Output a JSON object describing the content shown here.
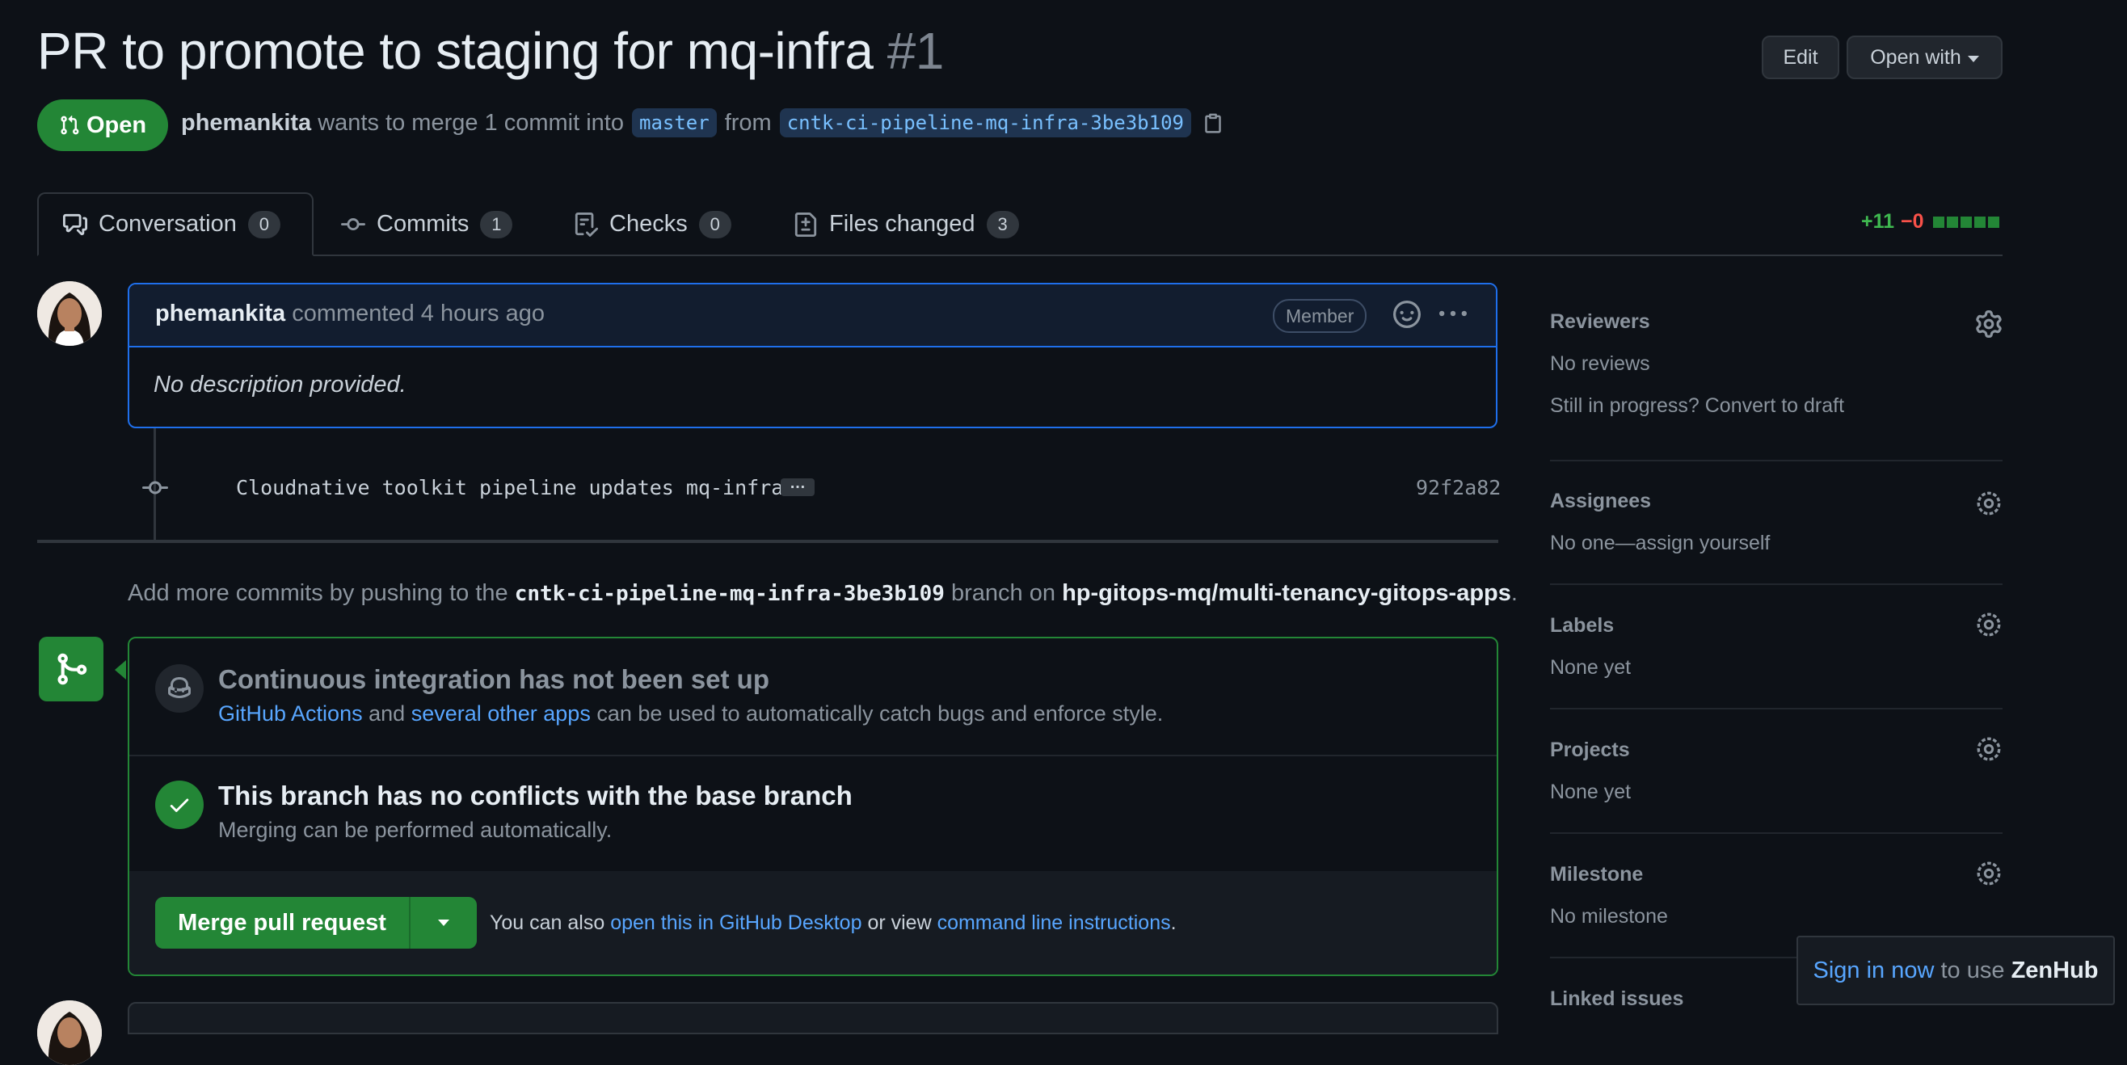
{
  "pr": {
    "title": "PR to promote to staging for mq-infra",
    "number": "#1",
    "state": "Open",
    "author": "phemankita",
    "merge_text": "wants to merge 1 commit into",
    "base_branch": "master",
    "from_text": "from",
    "head_branch": "cntk-ci-pipeline-mq-infra-3be3b109"
  },
  "header": {
    "edit_label": "Edit",
    "open_with_label": "Open with"
  },
  "tabs": [
    {
      "label": "Conversation",
      "count": "0"
    },
    {
      "label": "Commits",
      "count": "1"
    },
    {
      "label": "Checks",
      "count": "0"
    },
    {
      "label": "Files changed",
      "count": "3"
    }
  ],
  "diffstat": {
    "additions": "+11",
    "deletions": "−0"
  },
  "comment": {
    "author": "phemankita",
    "action": "commented 4 hours ago",
    "badge": "Member",
    "body": "No description provided."
  },
  "commit": {
    "message": "Cloudnative toolkit pipeline updates mq-infra",
    "more": "…",
    "sha": "92f2a82"
  },
  "push_note": {
    "prefix": "Add more commits by pushing to the",
    "branch": "cntk-ci-pipeline-mq-infra-3be3b109",
    "middle": "branch on",
    "repo": "hp-gitops-mq/multi-tenancy-gitops-apps",
    "suffix": "."
  },
  "merge_box": {
    "ci_title": "Continuous integration has not been set up",
    "ci_link1": "GitHub Actions",
    "ci_and": "and",
    "ci_link2": "several other apps",
    "ci_rest": "can be used to automatically catch bugs and enforce style.",
    "nc_title": "This branch has no conflicts with the base branch",
    "nc_desc": "Merging can be performed automatically.",
    "merge_button": "Merge pull request",
    "note_prefix": "You can also",
    "note_link1": "open this in GitHub Desktop",
    "note_mid": "or view",
    "note_link2": "command line instructions",
    "note_suffix": "."
  },
  "sidebar": {
    "reviewers": {
      "title": "Reviewers",
      "value": "No reviews",
      "extra": "Still in progress? Convert to draft"
    },
    "assignees": {
      "title": "Assignees",
      "value": "No one—assign yourself"
    },
    "labels": {
      "title": "Labels",
      "value": "None yet"
    },
    "projects": {
      "title": "Projects",
      "value": "None yet"
    },
    "milestone": {
      "title": "Milestone",
      "value": "No milestone"
    },
    "linked_issues": {
      "title": "Linked issues"
    }
  },
  "zenhub": {
    "link": "Sign in now",
    "middle": "to use",
    "brand": "ZenHub"
  },
  "colors": {
    "accent_green": "#238636",
    "link_blue": "#58a6ff",
    "background": "#0d1117"
  }
}
